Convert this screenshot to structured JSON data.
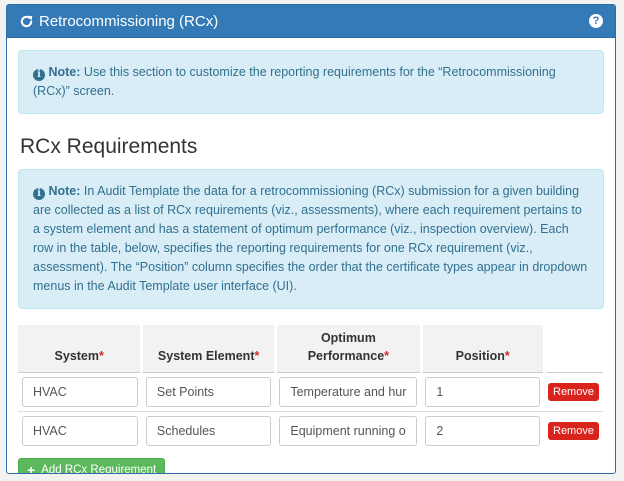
{
  "header": {
    "title": "Retrocommissioning (RCx)",
    "help_glyph": "?"
  },
  "note1": {
    "label": "Note:",
    "text": "Use this section to customize the reporting requirements for the “Retrocommissioning (RCx)” screen."
  },
  "section": {
    "title": "RCx Requirements"
  },
  "note2": {
    "label": "Note:",
    "text": "In Audit Template the data for a retrocommissioning (RCx) submission for a given building are collected as a list of RCx requirements (viz., assessments), where each requirement pertains to a system element and has a statement of optimum performance (viz., inspection overview). Each row in the table, below, specifies the reporting requirements for one RCx requirement (viz., assessment). The “Position” column specifies the order that the certificate types appear in dropdown menus in the Audit Template user interface (UI)."
  },
  "table": {
    "columns": {
      "system": "System",
      "system_element": "System Element",
      "optimum_performance_line1": "Optimum",
      "optimum_performance_line2": "Performance",
      "position": "Position",
      "required_marker": "*"
    },
    "rows": [
      {
        "system": "HVAC",
        "system_element": "Set Points",
        "optimum_performance": "Temperature and hur",
        "position": "1",
        "remove_label": "Remove"
      },
      {
        "system": "HVAC",
        "system_element": "Schedules",
        "optimum_performance": "Equipment running o",
        "position": "2",
        "remove_label": "Remove"
      }
    ]
  },
  "add_button": {
    "label": "Add RCx Requirement",
    "icon": "plus-icon"
  },
  "colors": {
    "header_bg": "#337ab7",
    "alert_bg": "#d9edf7",
    "alert_text": "#31708f",
    "remove_bg": "#d9241e",
    "add_bg": "#5cb85c",
    "required_star": "#c9302c"
  }
}
